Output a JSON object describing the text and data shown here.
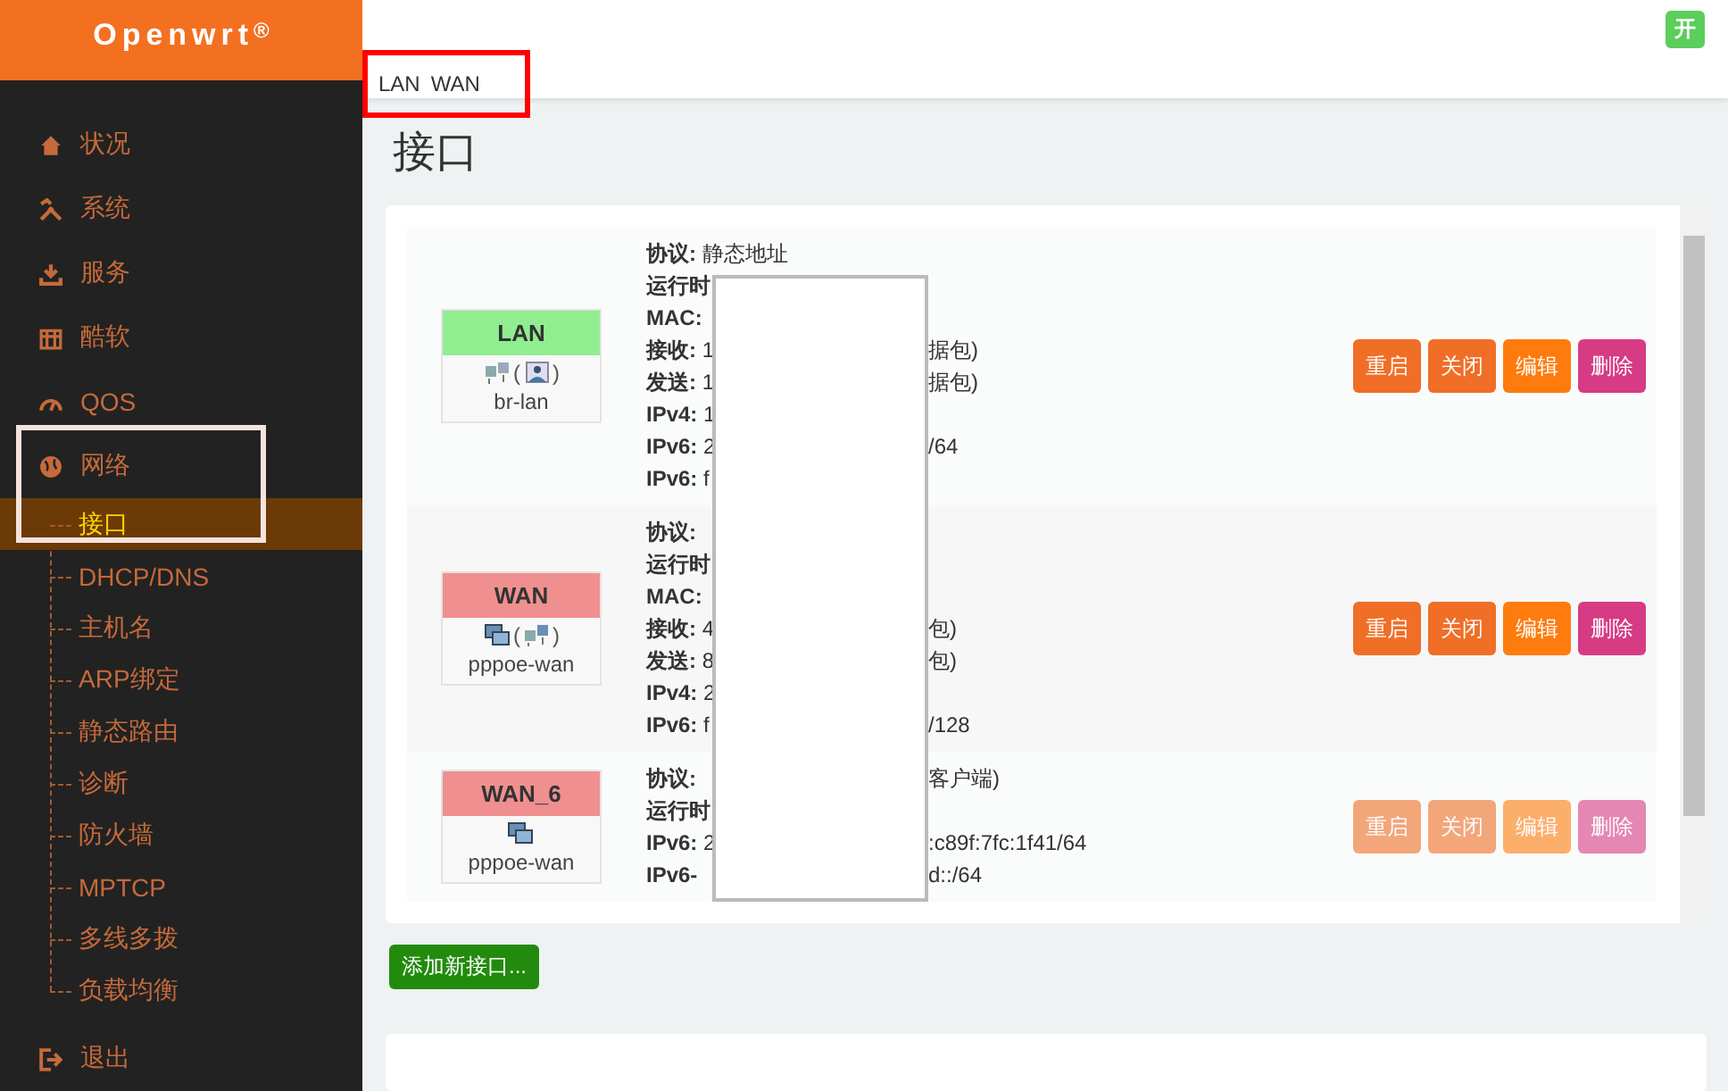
{
  "brand": {
    "name": "Openwrt",
    "mark": "®"
  },
  "sidebar": {
    "items": [
      {
        "label": "状况"
      },
      {
        "label": "系统"
      },
      {
        "label": "服务"
      },
      {
        "label": "酷软"
      },
      {
        "label": "QOS"
      },
      {
        "label": "网络",
        "children": [
          {
            "label": "接口",
            "selected": true
          },
          {
            "label": "DHCP/DNS",
            "selected": false
          },
          {
            "label": "主机名",
            "selected": false
          },
          {
            "label": "ARP绑定",
            "selected": false
          },
          {
            "label": "静态路由",
            "selected": false
          },
          {
            "label": "诊断",
            "selected": false
          },
          {
            "label": "防火墙",
            "selected": false
          },
          {
            "label": "MPTCP",
            "selected": false
          },
          {
            "label": "多线多拨",
            "selected": false
          },
          {
            "label": "负载均衡",
            "selected": false
          }
        ]
      },
      {
        "label": "退出"
      }
    ]
  },
  "header": {
    "badge": "开"
  },
  "breadcrumb": [
    "LAN",
    "WAN"
  ],
  "page_title": "接口",
  "interfaces": [
    {
      "name": "LAN",
      "up": true,
      "paren_open": "(",
      "paren_close": ")",
      "device": "br-lan",
      "buttons_disabled": false,
      "lines": [
        {
          "kind": "full",
          "label": "协议:",
          "value": "静态地址"
        },
        {
          "kind": "split",
          "label": "运行时"
        },
        {
          "kind": "split",
          "label": "MAC:"
        },
        {
          "kind": "split",
          "label": "接收:",
          "value": "1",
          "tail": "据包)"
        },
        {
          "kind": "split",
          "label": "发送:",
          "value": "1",
          "tail": "据包)"
        },
        {
          "kind": "split",
          "label": "IPv4:",
          "value": "1"
        },
        {
          "kind": "split",
          "label": "IPv6:",
          "value": "2",
          "tail": "/64"
        },
        {
          "kind": "split",
          "label": "IPv6:",
          "value": "f"
        }
      ],
      "buttons": [
        {
          "label": "重启",
          "kind": "restart"
        },
        {
          "label": "关闭",
          "kind": "stop"
        },
        {
          "label": "编辑",
          "kind": "edit"
        },
        {
          "label": "删除",
          "kind": "delete"
        }
      ]
    },
    {
      "name": "WAN",
      "up": false,
      "paren_open": "(",
      "paren_close": ")",
      "device": "pppoe-wan",
      "buttons_disabled": false,
      "lines": [
        {
          "kind": "split",
          "label": "协议:"
        },
        {
          "kind": "split",
          "label": "运行时"
        },
        {
          "kind": "split",
          "label": "MAC:"
        },
        {
          "kind": "split",
          "label": "接收:",
          "value": "4",
          "tail": "包)"
        },
        {
          "kind": "split",
          "label": "发送:",
          "value": "8",
          "tail": "包)"
        },
        {
          "kind": "split",
          "label": "IPv4:",
          "value": "2"
        },
        {
          "kind": "split",
          "label": "IPv6:",
          "value": "f",
          "tail": "/128"
        }
      ],
      "buttons": [
        {
          "label": "重启",
          "kind": "restart"
        },
        {
          "label": "关闭",
          "kind": "stop"
        },
        {
          "label": "编辑",
          "kind": "edit"
        },
        {
          "label": "删除",
          "kind": "delete"
        }
      ]
    },
    {
      "name": "WAN_6",
      "up": false,
      "device": "pppoe-wan",
      "buttons_disabled": true,
      "lines": [
        {
          "kind": "split",
          "label": "协议:",
          "tail": "客户端)"
        },
        {
          "kind": "split",
          "label": "运行时"
        },
        {
          "kind": "split",
          "label": "IPv6:",
          "value": "2",
          "tail": ":c89f:7fc:1f41/64"
        },
        {
          "kind": "split",
          "label": "IPv6-",
          "tail": "d::/64"
        }
      ],
      "buttons": [
        {
          "label": "重启",
          "kind": "restart"
        },
        {
          "label": "关闭",
          "kind": "stop"
        },
        {
          "label": "编辑",
          "kind": "edit"
        },
        {
          "label": "删除",
          "kind": "delete"
        }
      ]
    }
  ],
  "add_button": "添加新接口..."
}
